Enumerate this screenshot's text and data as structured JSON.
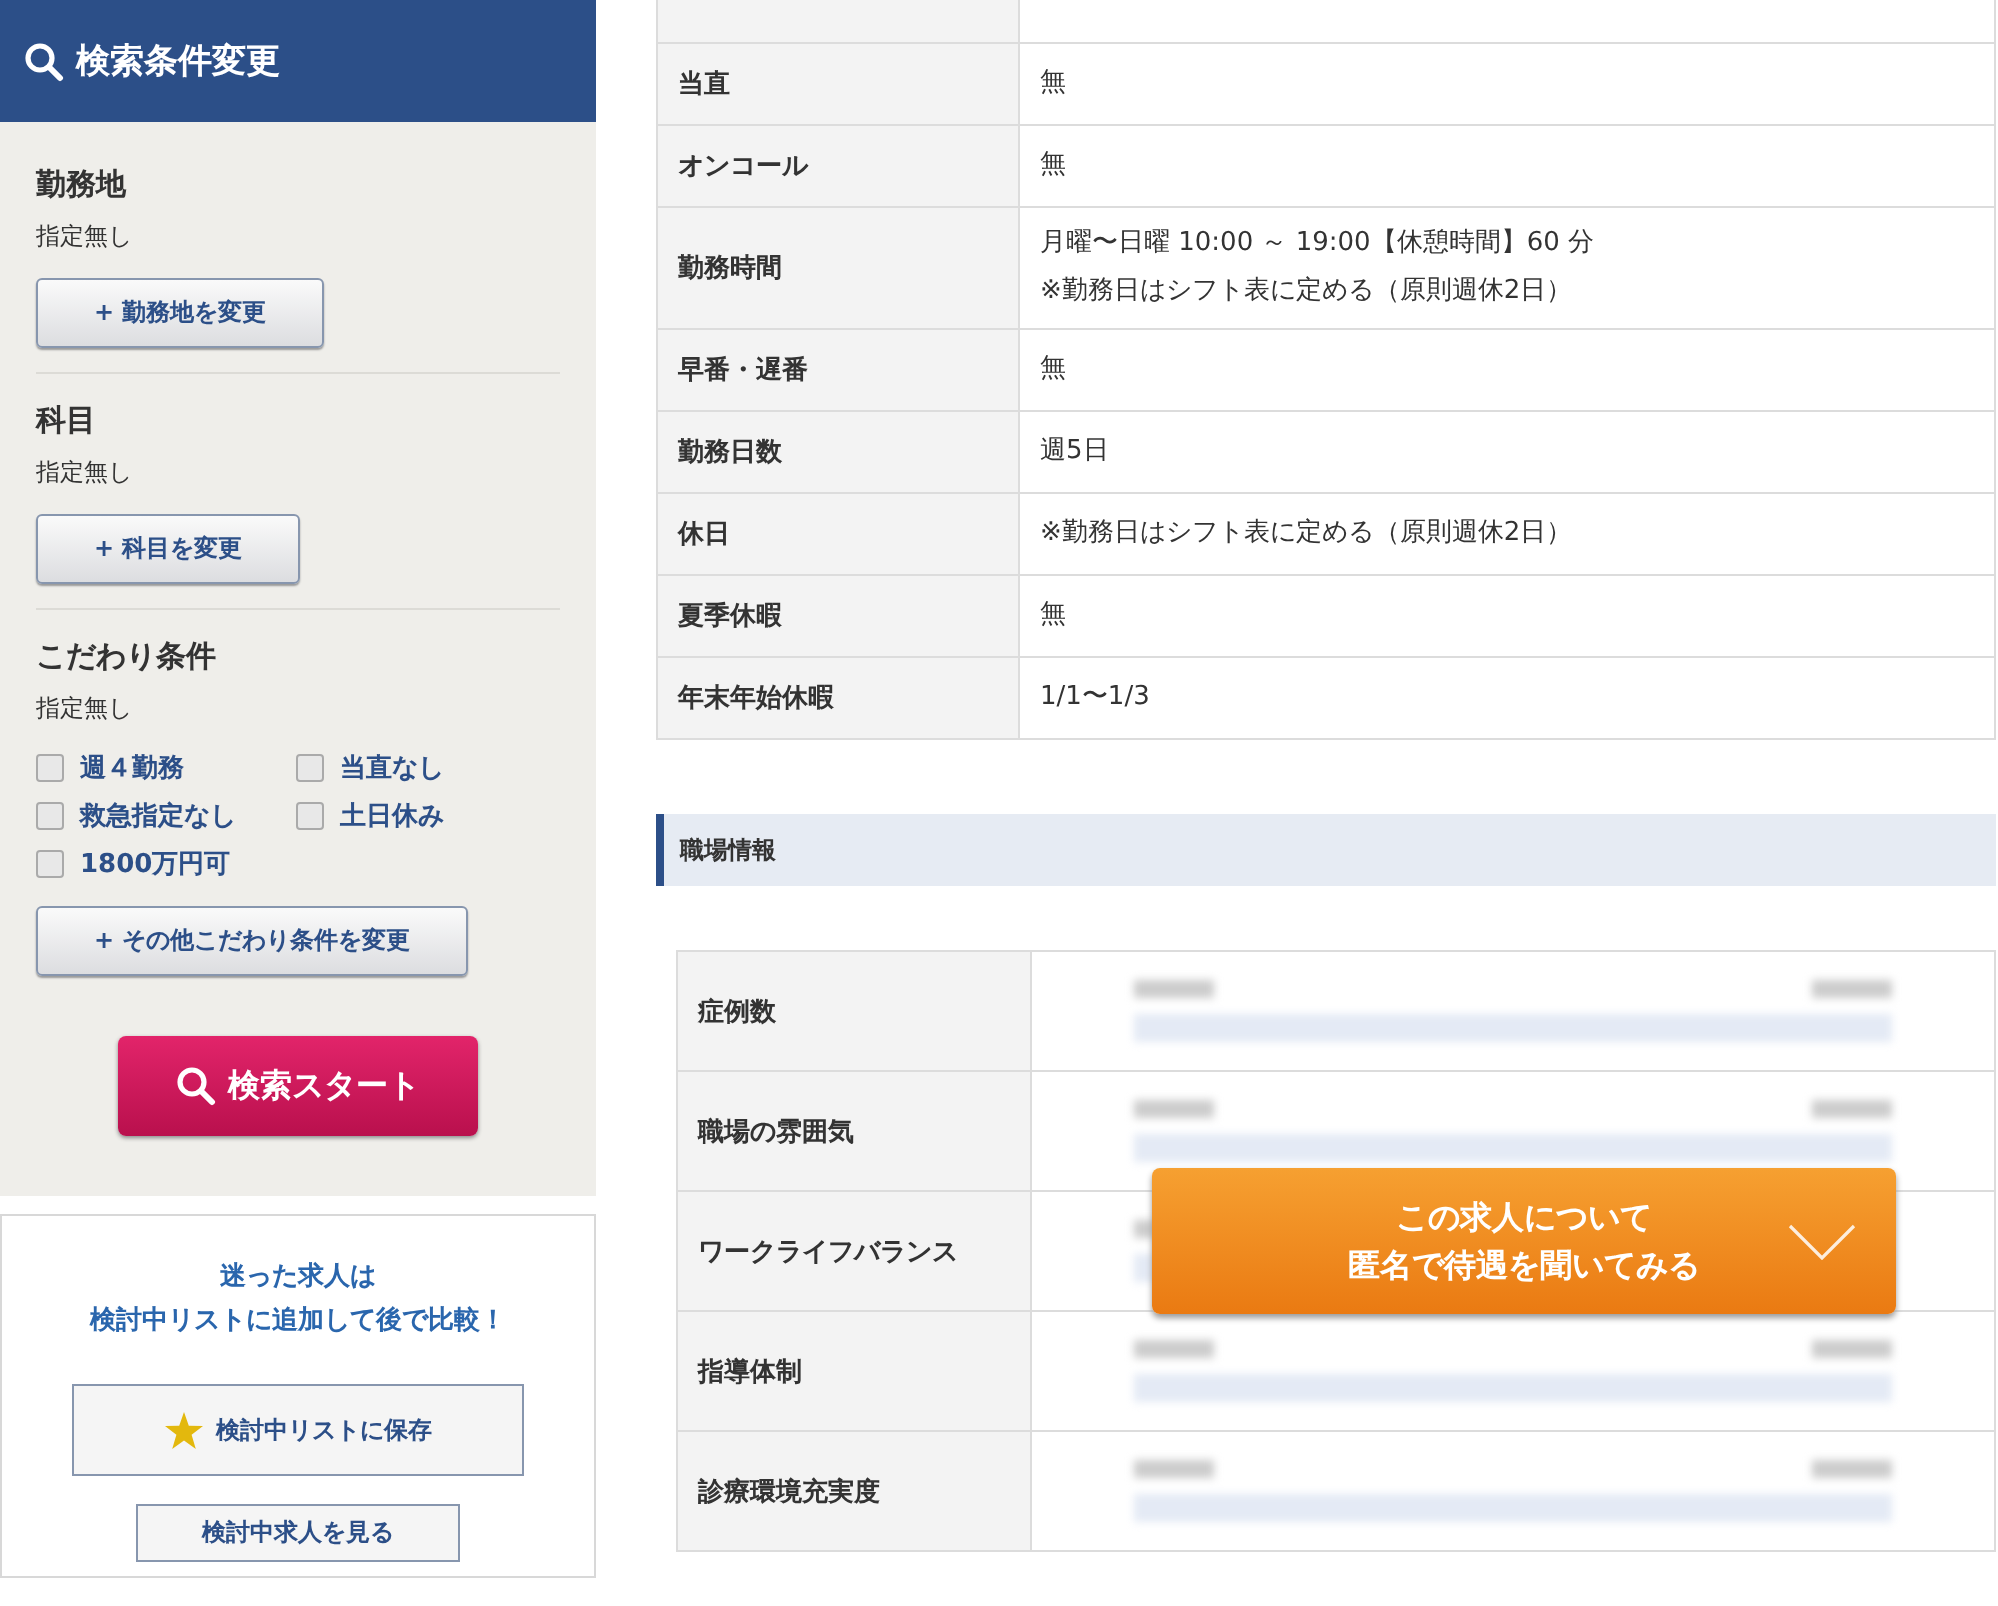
{
  "sidebar": {
    "title": "検索条件変更",
    "sections": [
      {
        "heading": "勤務地",
        "value": "指定無し",
        "button": "+ 勤務地を変更"
      },
      {
        "heading": "科目",
        "value": "指定無し",
        "button": "+ 科目を変更"
      },
      {
        "heading": "こだわり条件",
        "value": "指定無し",
        "options": [
          {
            "label": "週４勤務",
            "checked": false
          },
          {
            "label": "当直なし",
            "checked": false
          },
          {
            "label": "救急指定なし",
            "checked": false
          },
          {
            "label": "土日休み",
            "checked": false
          },
          {
            "label": "1800万円可",
            "checked": false
          }
        ],
        "button": "+ その他こだわり条件を変更"
      }
    ],
    "search_button": "検索スタート",
    "save_box": {
      "message": [
        "迷った求人は",
        "検討中リストに追加して後で比較！"
      ],
      "save_button": "検討中リストに保存",
      "view_button": "検討中求人を見る"
    }
  },
  "conditions": [
    {
      "label": "当直",
      "value": [
        "無"
      ]
    },
    {
      "label": "オンコール",
      "value": [
        "無"
      ]
    },
    {
      "label": "勤務時間",
      "value": [
        "月曜〜日曜 10:00 ～ 19:00【休憩時間】60 分",
        "※勤務日はシフト表に定める（原則週休2日）"
      ]
    },
    {
      "label": "早番・遅番",
      "value": [
        "無"
      ]
    },
    {
      "label": "勤務日数",
      "value": [
        "週5日"
      ]
    },
    {
      "label": "休日",
      "value": [
        "※勤務日はシフト表に定める（原則週休2日）"
      ]
    },
    {
      "label": "夏季休暇",
      "value": [
        "無"
      ]
    },
    {
      "label": "年末年始休暇",
      "value": [
        "1/1〜1/3"
      ]
    }
  ],
  "workplace": {
    "heading": "職場情報",
    "rows": [
      {
        "label": "症例数"
      },
      {
        "label": "職場の雰囲気"
      },
      {
        "label": "ワークライフバランス"
      },
      {
        "label": "指導体制"
      },
      {
        "label": "診療環境充実度"
      }
    ],
    "inquiry_button": [
      "この求人について",
      "匿名で待遇を聞いてみる"
    ]
  }
}
